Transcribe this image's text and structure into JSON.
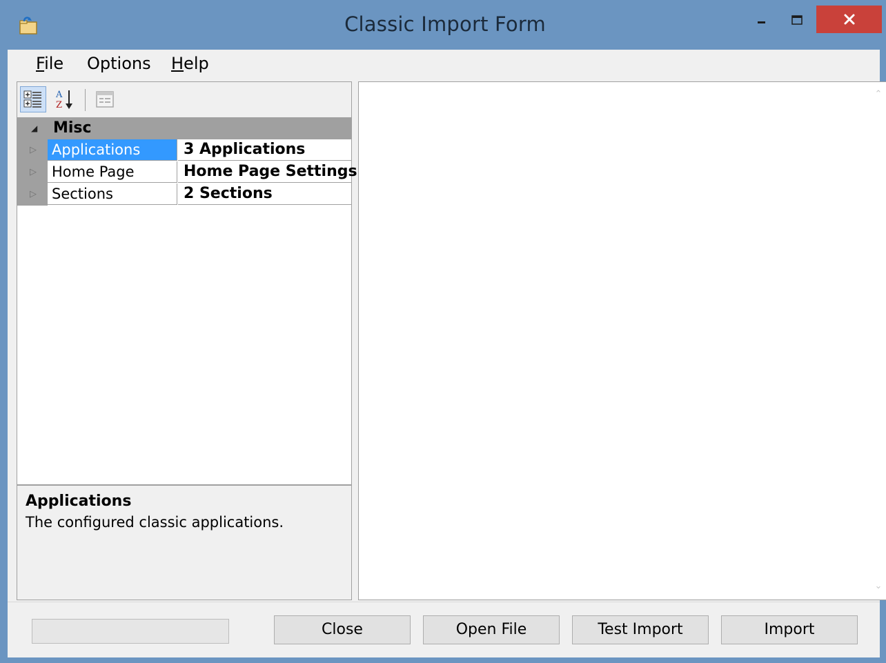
{
  "window": {
    "title": "Classic Import Form",
    "icons": {
      "app": "app-icon",
      "minimize": "minimize-icon",
      "maximize": "maximize-icon",
      "close": "close-icon"
    }
  },
  "menu": {
    "items": [
      {
        "mnemonic": "F",
        "rest": "ile"
      },
      {
        "mnemonic": "",
        "rest": "Options"
      },
      {
        "mnemonic": "H",
        "rest": "elp"
      }
    ]
  },
  "property_grid": {
    "toolbar_icons": [
      "categorized-icon",
      "alphabetical-sort-icon",
      "property-pages-icon"
    ],
    "category": "Misc",
    "rows": [
      {
        "name": "Applications",
        "value": "3 Applications",
        "selected": true
      },
      {
        "name": "Home Page",
        "value": "Home Page Settings",
        "selected": false
      },
      {
        "name": "Sections",
        "value": "2 Sections",
        "selected": false
      }
    ],
    "description": {
      "title": "Applications",
      "text": "The configured classic applications."
    }
  },
  "footer": {
    "progress": 0,
    "buttons": {
      "close": "Close",
      "open_file": "Open File",
      "test_import": "Test Import",
      "import": "Import"
    }
  },
  "colors": {
    "title_bar": "#6b95c1",
    "close_button": "#c9413a",
    "selection": "#3399ff",
    "category_band": "#a0a0a0"
  }
}
